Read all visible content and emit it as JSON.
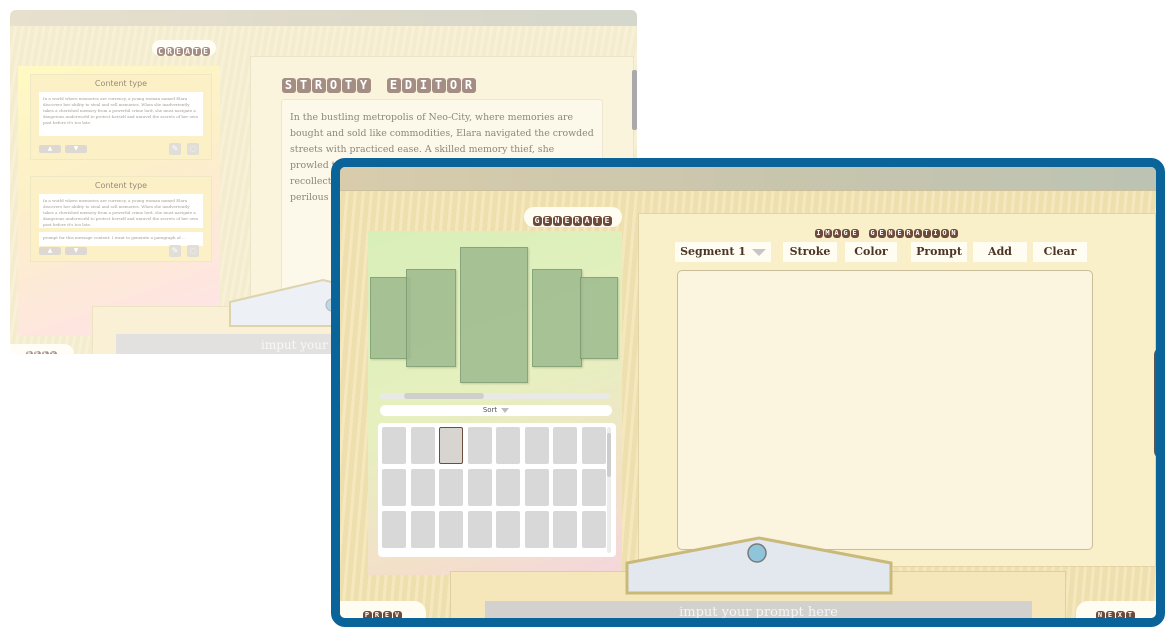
{
  "back_window": {
    "create_label": "CREATE",
    "editor_title": "STROTY EDITOR",
    "story_text": "In the bustling metropolis of Neo-City, where memories are bought and sold like commodities, Elara navigated the crowded streets with practiced ease. A skilled memory thief, she prowled the shadows, her mind honed to extract precious recollections from unwitting targets. But when ... notorious ... perilous g... must evad... her own f... a race aga... another fo...",
    "cards": [
      {
        "title": "Content type",
        "text": "In a world where memories are currency, a young woman named Elara discovers her ability to steal and sell memories. When she inadvertently takes a cherished memory from a powerful crime lord, she must navigate a dangerous underworld to protect herself and unravel the secrets of her own past before it's too late."
      },
      {
        "title": "Content type",
        "text": "In a world where memories are currency, a young woman named Elara discovers her ability to steal and sell memories. When she inadvertently takes a cherished memory from a powerful crime lord, she must navigate a dangerous underworld to protect herself and unravel the secrets of her own past before it's too late.",
        "prompt": "prompt for this message content: I want to generate a paragraph of ..."
      }
    ],
    "prev_label": "PREV",
    "prompt_placeholder": "imput your p"
  },
  "front_window": {
    "generate_label": "GENERATE",
    "sort_label": "Sort",
    "panel_title": "IMAGE GENERATION",
    "toolbar": {
      "segment": "Segment 1",
      "stroke": "Stroke",
      "color": "Color",
      "prompt": "Prompt",
      "add": "Add",
      "clear": "Clear"
    },
    "prev_label": "PREV",
    "next_label": "NEXT",
    "prompt_placeholder": "imput your prompt here"
  },
  "colors": {
    "accent_border": "#0a6399",
    "tile_brown": "#6d4a3a",
    "wood": "#f3e4b1"
  }
}
